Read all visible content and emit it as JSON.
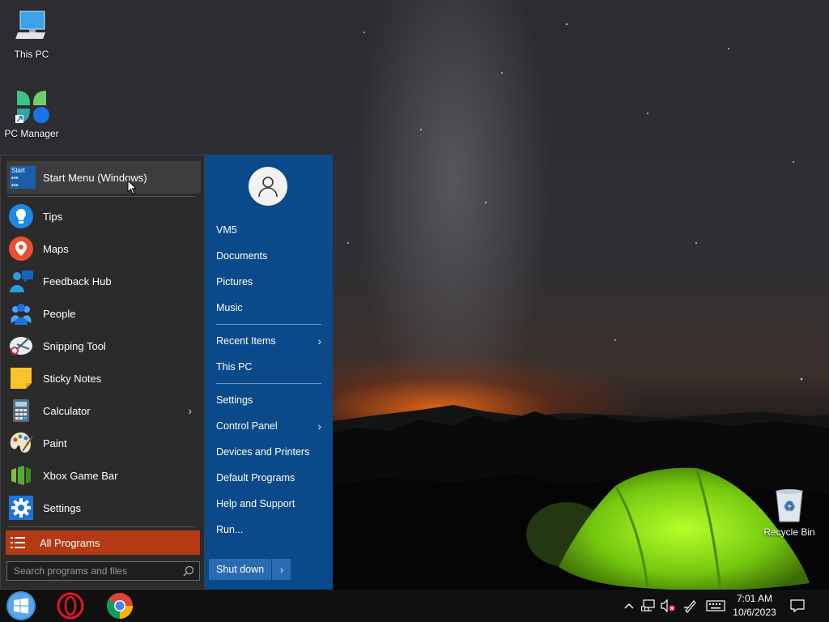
{
  "desktop": {
    "icons": [
      {
        "label": "This PC"
      },
      {
        "label": "PC Manager"
      },
      {
        "label": "Recycle Bin"
      }
    ]
  },
  "start_menu": {
    "top_item": {
      "label": "Start Menu (Windows)",
      "tile_text": "Start"
    },
    "programs": [
      {
        "label": "Tips",
        "icon": "lightbulb-icon"
      },
      {
        "label": "Maps",
        "icon": "map-pin-icon"
      },
      {
        "label": "Feedback Hub",
        "icon": "feedback-icon"
      },
      {
        "label": "People",
        "icon": "people-icon"
      },
      {
        "label": "Snipping Tool",
        "icon": "scissors-icon"
      },
      {
        "label": "Sticky Notes",
        "icon": "sticky-note-icon"
      },
      {
        "label": "Calculator",
        "icon": "calculator-icon",
        "has_submenu": true
      },
      {
        "label": "Paint",
        "icon": "palette-icon"
      },
      {
        "label": "Xbox Game Bar",
        "icon": "game-bar-icon"
      },
      {
        "label": "Settings",
        "icon": "gear-icon"
      }
    ],
    "all_programs": "All Programs",
    "search_placeholder": "Search programs and files",
    "right_items": [
      {
        "label": "VM5"
      },
      {
        "label": "Documents"
      },
      {
        "label": "Pictures"
      },
      {
        "label": "Music"
      },
      {
        "label": "Recent Items",
        "has_submenu": true
      },
      {
        "label": "This PC"
      },
      {
        "label": "Settings"
      },
      {
        "label": "Control Panel",
        "has_submenu": true
      },
      {
        "label": "Devices and Printers"
      },
      {
        "label": "Default Programs"
      },
      {
        "label": "Help and Support"
      },
      {
        "label": "Run..."
      }
    ],
    "shutdown": "Shut down",
    "colors": {
      "left_bg": "#2b2b2b",
      "right_bg": "#0b4a8a",
      "all_programs_bg": "#b33a12"
    }
  },
  "taskbar": {
    "pinned": [
      {
        "icon": "windows-start-icon"
      },
      {
        "icon": "opera-icon"
      },
      {
        "icon": "chrome-icon"
      }
    ],
    "tray": {
      "time": "7:01 AM",
      "date": "10/6/2023"
    }
  }
}
